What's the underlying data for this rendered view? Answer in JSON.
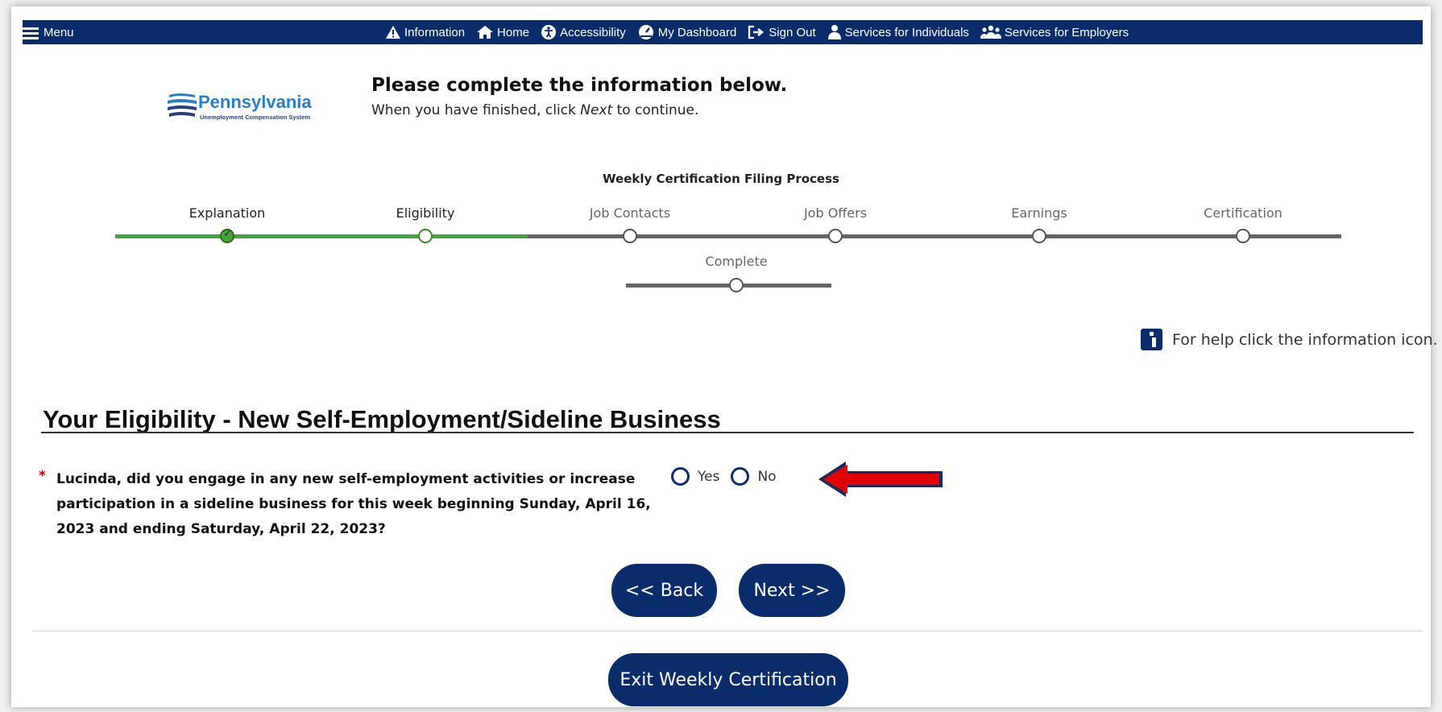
{
  "nav": {
    "menu_label": "Menu",
    "links": [
      {
        "label": "Information",
        "icon": "warning-icon"
      },
      {
        "label": "Home",
        "icon": "home-icon"
      },
      {
        "label": "Accessibility",
        "icon": "accessibility-icon"
      },
      {
        "label": "My Dashboard",
        "icon": "dashboard-icon"
      },
      {
        "label": "Sign Out",
        "icon": "sign-out-icon"
      },
      {
        "label": "Services for Individuals",
        "icon": "person-icon"
      },
      {
        "label": "Services for Employers",
        "icon": "group-icon"
      }
    ]
  },
  "logo": {
    "name": "Pennsylvania",
    "subtitle": "Unemployment Compensation System"
  },
  "instructions": {
    "title": "Please complete the information below.",
    "sub_before": "When you have finished, click ",
    "sub_em": "Next",
    "sub_after": " to continue."
  },
  "process": {
    "title": "Weekly Certification Filing Process",
    "steps": [
      {
        "label": "Explanation",
        "state": "done"
      },
      {
        "label": "Eligibility",
        "state": "current"
      },
      {
        "label": "Job Contacts",
        "state": "future"
      },
      {
        "label": "Job Offers",
        "state": "future"
      },
      {
        "label": "Earnings",
        "state": "future"
      },
      {
        "label": "Certification",
        "state": "future"
      },
      {
        "label": "Complete",
        "state": "future"
      }
    ]
  },
  "help_text": "For help click the information icon.",
  "section": {
    "title": "Your Eligibility - New Self-Employment/Sideline Business",
    "question": "Lucinda, did you engage in any new self-employment activities or increase participation in a sideline business for this week beginning Sunday, April 16, 2023 and ending Saturday, April 22, 2023?",
    "required_mark": "*",
    "options": [
      "Yes",
      "No"
    ]
  },
  "buttons": {
    "back": "<< Back",
    "next": "Next >>",
    "exit": "Exit Weekly Certification"
  },
  "colors": {
    "nav_bg": "#0b2c6b",
    "progress_done": "#4aa33a",
    "progress_todo": "#666666",
    "arrow": "#e00000"
  }
}
